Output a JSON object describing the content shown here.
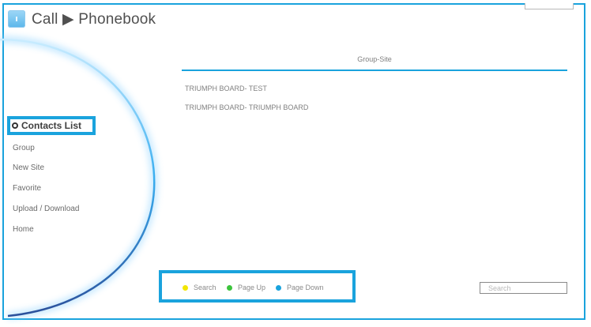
{
  "header": {
    "title": "Call ▶ Phonebook"
  },
  "table": {
    "column": "Group-Site",
    "rows": [
      "TRIUMPH BOARD- TEST",
      "TRIUMPH BOARD- TRIUMPH BOARD"
    ]
  },
  "sidebar": {
    "active": "Contacts List",
    "items": [
      "Group",
      "New Site",
      "Favorite",
      "Upload / Download",
      "Home"
    ]
  },
  "keys": [
    {
      "label": "Search",
      "color": "#f2e600"
    },
    {
      "label": "Page Up",
      "color": "#3cc43c"
    },
    {
      "label": "Page Down",
      "color": "#1aa3dd"
    }
  ],
  "search": {
    "placeholder": "Search"
  },
  "colors": {
    "accent": "#1aa3dd"
  }
}
